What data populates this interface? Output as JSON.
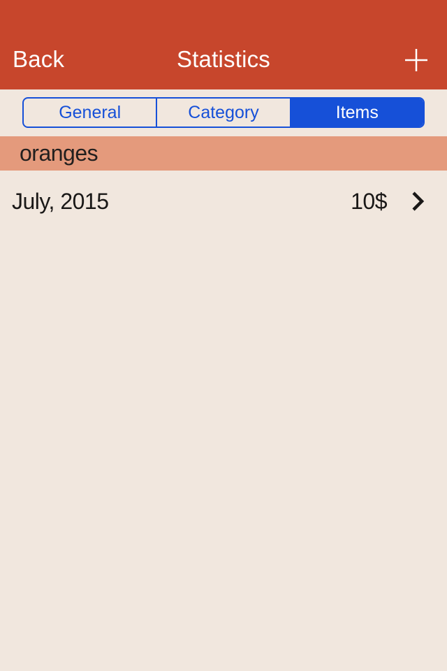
{
  "header": {
    "back_label": "Back",
    "title": "Statistics"
  },
  "segments": {
    "general": "General",
    "category": "Category",
    "items": "Items",
    "selected": "items"
  },
  "section": {
    "title": "oranges"
  },
  "rows": [
    {
      "title": "July, 2015",
      "amount": "10$"
    }
  ],
  "colors": {
    "header_bg": "#c7462c",
    "body_bg": "#f1e7de",
    "accent": "#1650d8",
    "section_bg": "#e49a7c"
  }
}
